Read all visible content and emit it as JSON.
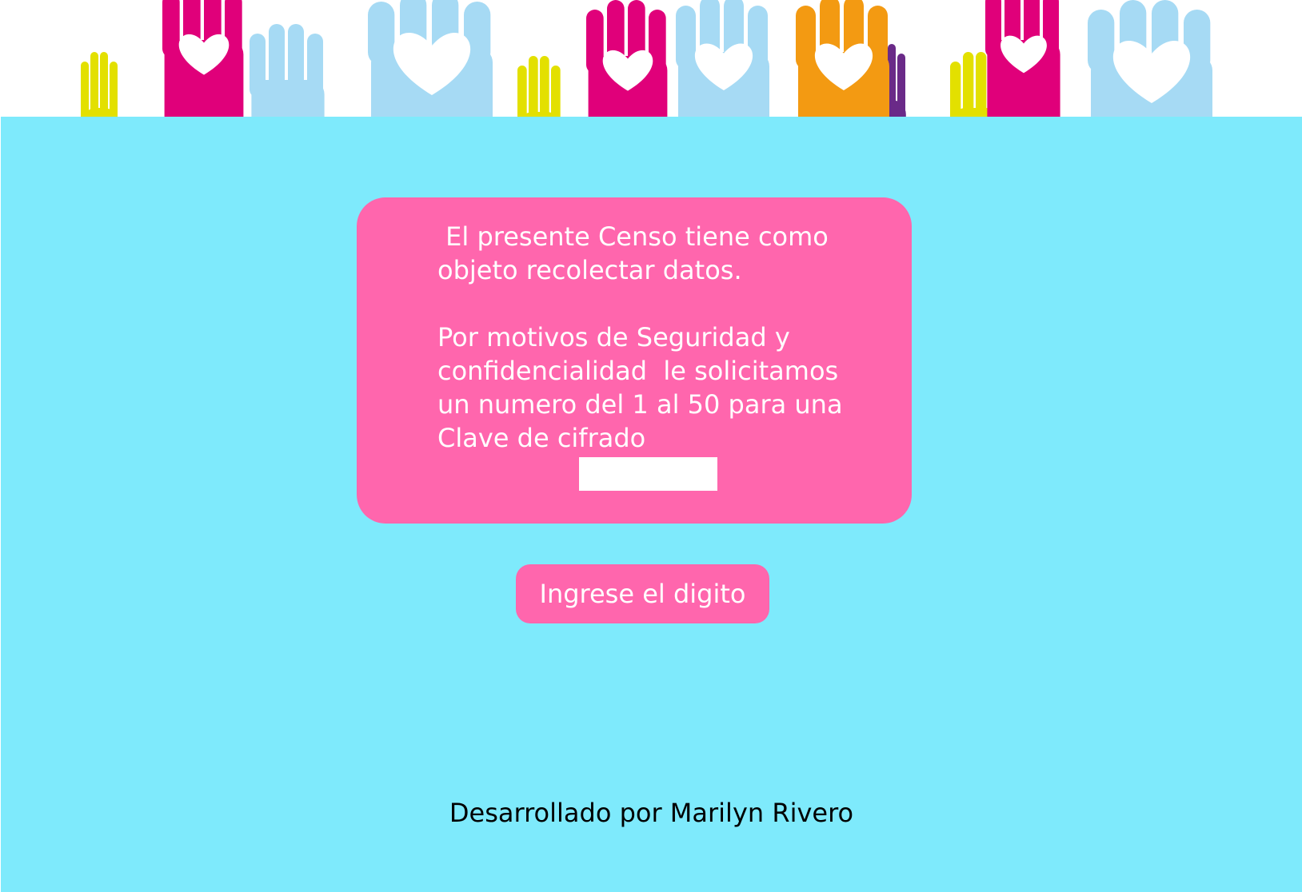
{
  "colors": {
    "background": "#7eeafc",
    "card": "#ff66ad",
    "button": "#ff66ad",
    "hand_magenta": "#e0007a",
    "hand_lightblue": "#a6daf4",
    "hand_yellow": "#e3e000",
    "hand_orange": "#f39a12",
    "hand_purple": "#6a2a88"
  },
  "banner": {
    "icon": "raised-hands-hearts-illustration"
  },
  "card": {
    "text": " El presente Censo tiene como\nobjeto recolectar datos.\n\nPor motivos de Seguridad y\nconfidencialidad  le solicitamos\nun numero del 1 al 50 para una\nClave de cifrado",
    "key_input_value": ""
  },
  "button": {
    "label": "Ingrese el digito"
  },
  "footer": {
    "text": "Desarrollado por Marilyn Rivero"
  }
}
